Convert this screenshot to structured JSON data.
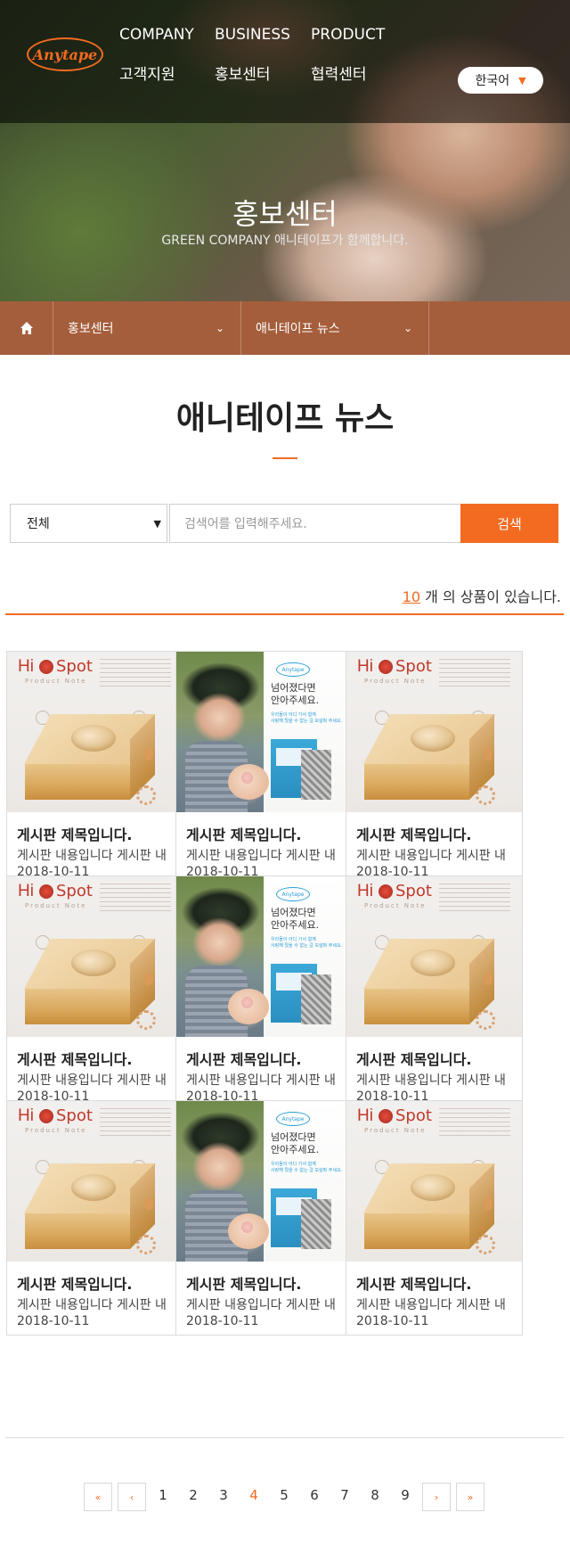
{
  "header": {
    "logo_text": "Anytape",
    "nav": [
      "COMPANY",
      "BUSINESS",
      "PRODUCT",
      "고객지원",
      "홍보센터",
      "협력센터"
    ],
    "language": "한국어"
  },
  "hero": {
    "title": "홍보센터",
    "subtitle": "GREEN COMPANY 애니테이프가 함께합니다."
  },
  "breadcrumb": {
    "level1": "홍보센터",
    "level2": "애니테이프 뉴스"
  },
  "page": {
    "title": "애니테이프 뉴스"
  },
  "search": {
    "category": "전체",
    "placeholder": "검색어를 입력해주세요.",
    "button": "검색"
  },
  "count": {
    "number": "10",
    "suffix": "개 의 상품이 있습니다."
  },
  "posts": [
    {
      "title": "게시판 제목입니다.",
      "desc": "게시판 내용입니다 게시판 내",
      "date": "2018-10-11",
      "thumb": "hispot"
    },
    {
      "title": "게시판 제목입니다.",
      "desc": "게시판 내용입니다 게시판 내",
      "date": "2018-10-11",
      "thumb": "kid"
    },
    {
      "title": "게시판 제목입니다.",
      "desc": "게시판 내용입니다 게시판 내",
      "date": "2018-10-11",
      "thumb": "hispot"
    },
    {
      "title": "게시판 제목입니다.",
      "desc": "게시판 내용입니다 게시판 내",
      "date": "2018-10-11",
      "thumb": "hispot"
    },
    {
      "title": "게시판 제목입니다.",
      "desc": "게시판 내용입니다 게시판 내",
      "date": "2018-10-11",
      "thumb": "kid"
    },
    {
      "title": "게시판 제목입니다.",
      "desc": "게시판 내용입니다 게시판 내",
      "date": "2018-10-11",
      "thumb": "hispot"
    },
    {
      "title": "게시판 제목입니다.",
      "desc": "게시판 내용입니다 게시판 내",
      "date": "2018-10-11",
      "thumb": "hispot"
    },
    {
      "title": "게시판 제목입니다.",
      "desc": "게시판 내용입니다 게시판 내",
      "date": "2018-10-11",
      "thumb": "kid"
    },
    {
      "title": "게시판 제목입니다.",
      "desc": "게시판 내용입니다 게시판 내",
      "date": "2018-10-11",
      "thumb": "hispot"
    }
  ],
  "thumb_text": {
    "hispot_brand_a": "Hi",
    "hispot_brand_b": "Spot",
    "hispot_sub": "Product Note",
    "kid_logo": "Anytape",
    "kid_headline": "넘어졌다면\n안아주세요.",
    "kid_small": "우리들이 어디 가서 함께\n사랑해 줬을 수 없는 걸 보살펴 주세요."
  },
  "pagination": {
    "first": "«",
    "prev": "‹",
    "pages": [
      "1",
      "2",
      "3",
      "4",
      "5",
      "6",
      "7",
      "8",
      "9"
    ],
    "current": "4",
    "next": "›",
    "last": "»"
  },
  "colors": {
    "accent": "#f26b21",
    "subnav": "#a55e3c"
  }
}
